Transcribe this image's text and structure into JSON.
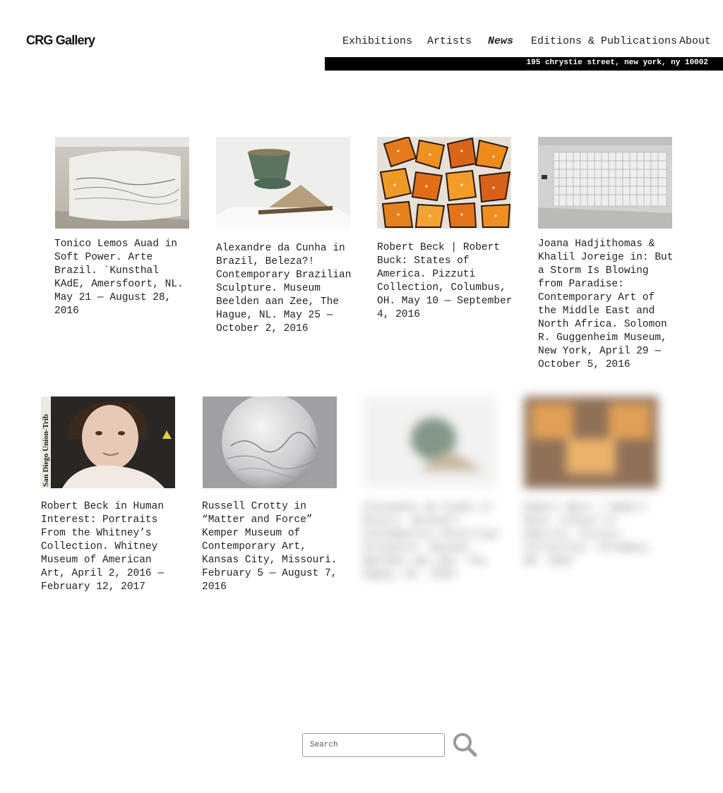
{
  "header": {
    "logo": "CRG Gallery",
    "nav": [
      {
        "label": "Exhibitions"
      },
      {
        "label": "Artists"
      },
      {
        "label": "News"
      },
      {
        "label": "Editions & Publications"
      },
      {
        "label": "About"
      }
    ],
    "address": "195 chrystie street, new york, ny 10002"
  },
  "news": [
    {
      "caption": "Tonico Lemos Auad in Soft Power. Arte Brazil. `Kunsthal KAdE, Amersfoort, NL. May 21 — August 28, 2016"
    },
    {
      "caption": "Alexandre da Cunha in Brazil, Beleza?! Contemporary Brazilian Sculpture. Museum Beelden aan Zee, The Hague, NL. May 25 — October 2, 2016"
    },
    {
      "caption": "Robert Beck | Robert Buck: States of America. Pizzuti Collection, Columbus, OH. May 10 — September 4, 2016"
    },
    {
      "caption": "Joana Hadjithomas & Khalil Joreige in: But a Storm Is Blowing from Paradise: Contemporary Art of the Middle East and North Africa. Solomon R. Guggenheim Museum, New York, April 29 — October 5, 2016"
    },
    {
      "caption": "Robert Beck in Human Interest: Portraits From the Whitney’s Collection. Whitney Museum of American Art, April 2, 2016 — February 12, 2017",
      "image_text": "San Diego Union-Trib"
    },
    {
      "caption": "Russell Crotty in “Matter and Force” Kemper Museum of Contemporary Art, Kansas City, Missouri. February 5 — August 7, 2016"
    },
    {
      "caption": "Alexandre da Cunha in Brazil, Beleza?! Contemporary Brazilian Sculpture. Museum Beelden aan Zee, The Hague, NL. 2016"
    },
    {
      "caption": "Robert Beck | Robert Buck: States of America. Pizzuti Collection, Columbus, OH. 2016"
    }
  ],
  "search": {
    "placeholder": "Search"
  }
}
